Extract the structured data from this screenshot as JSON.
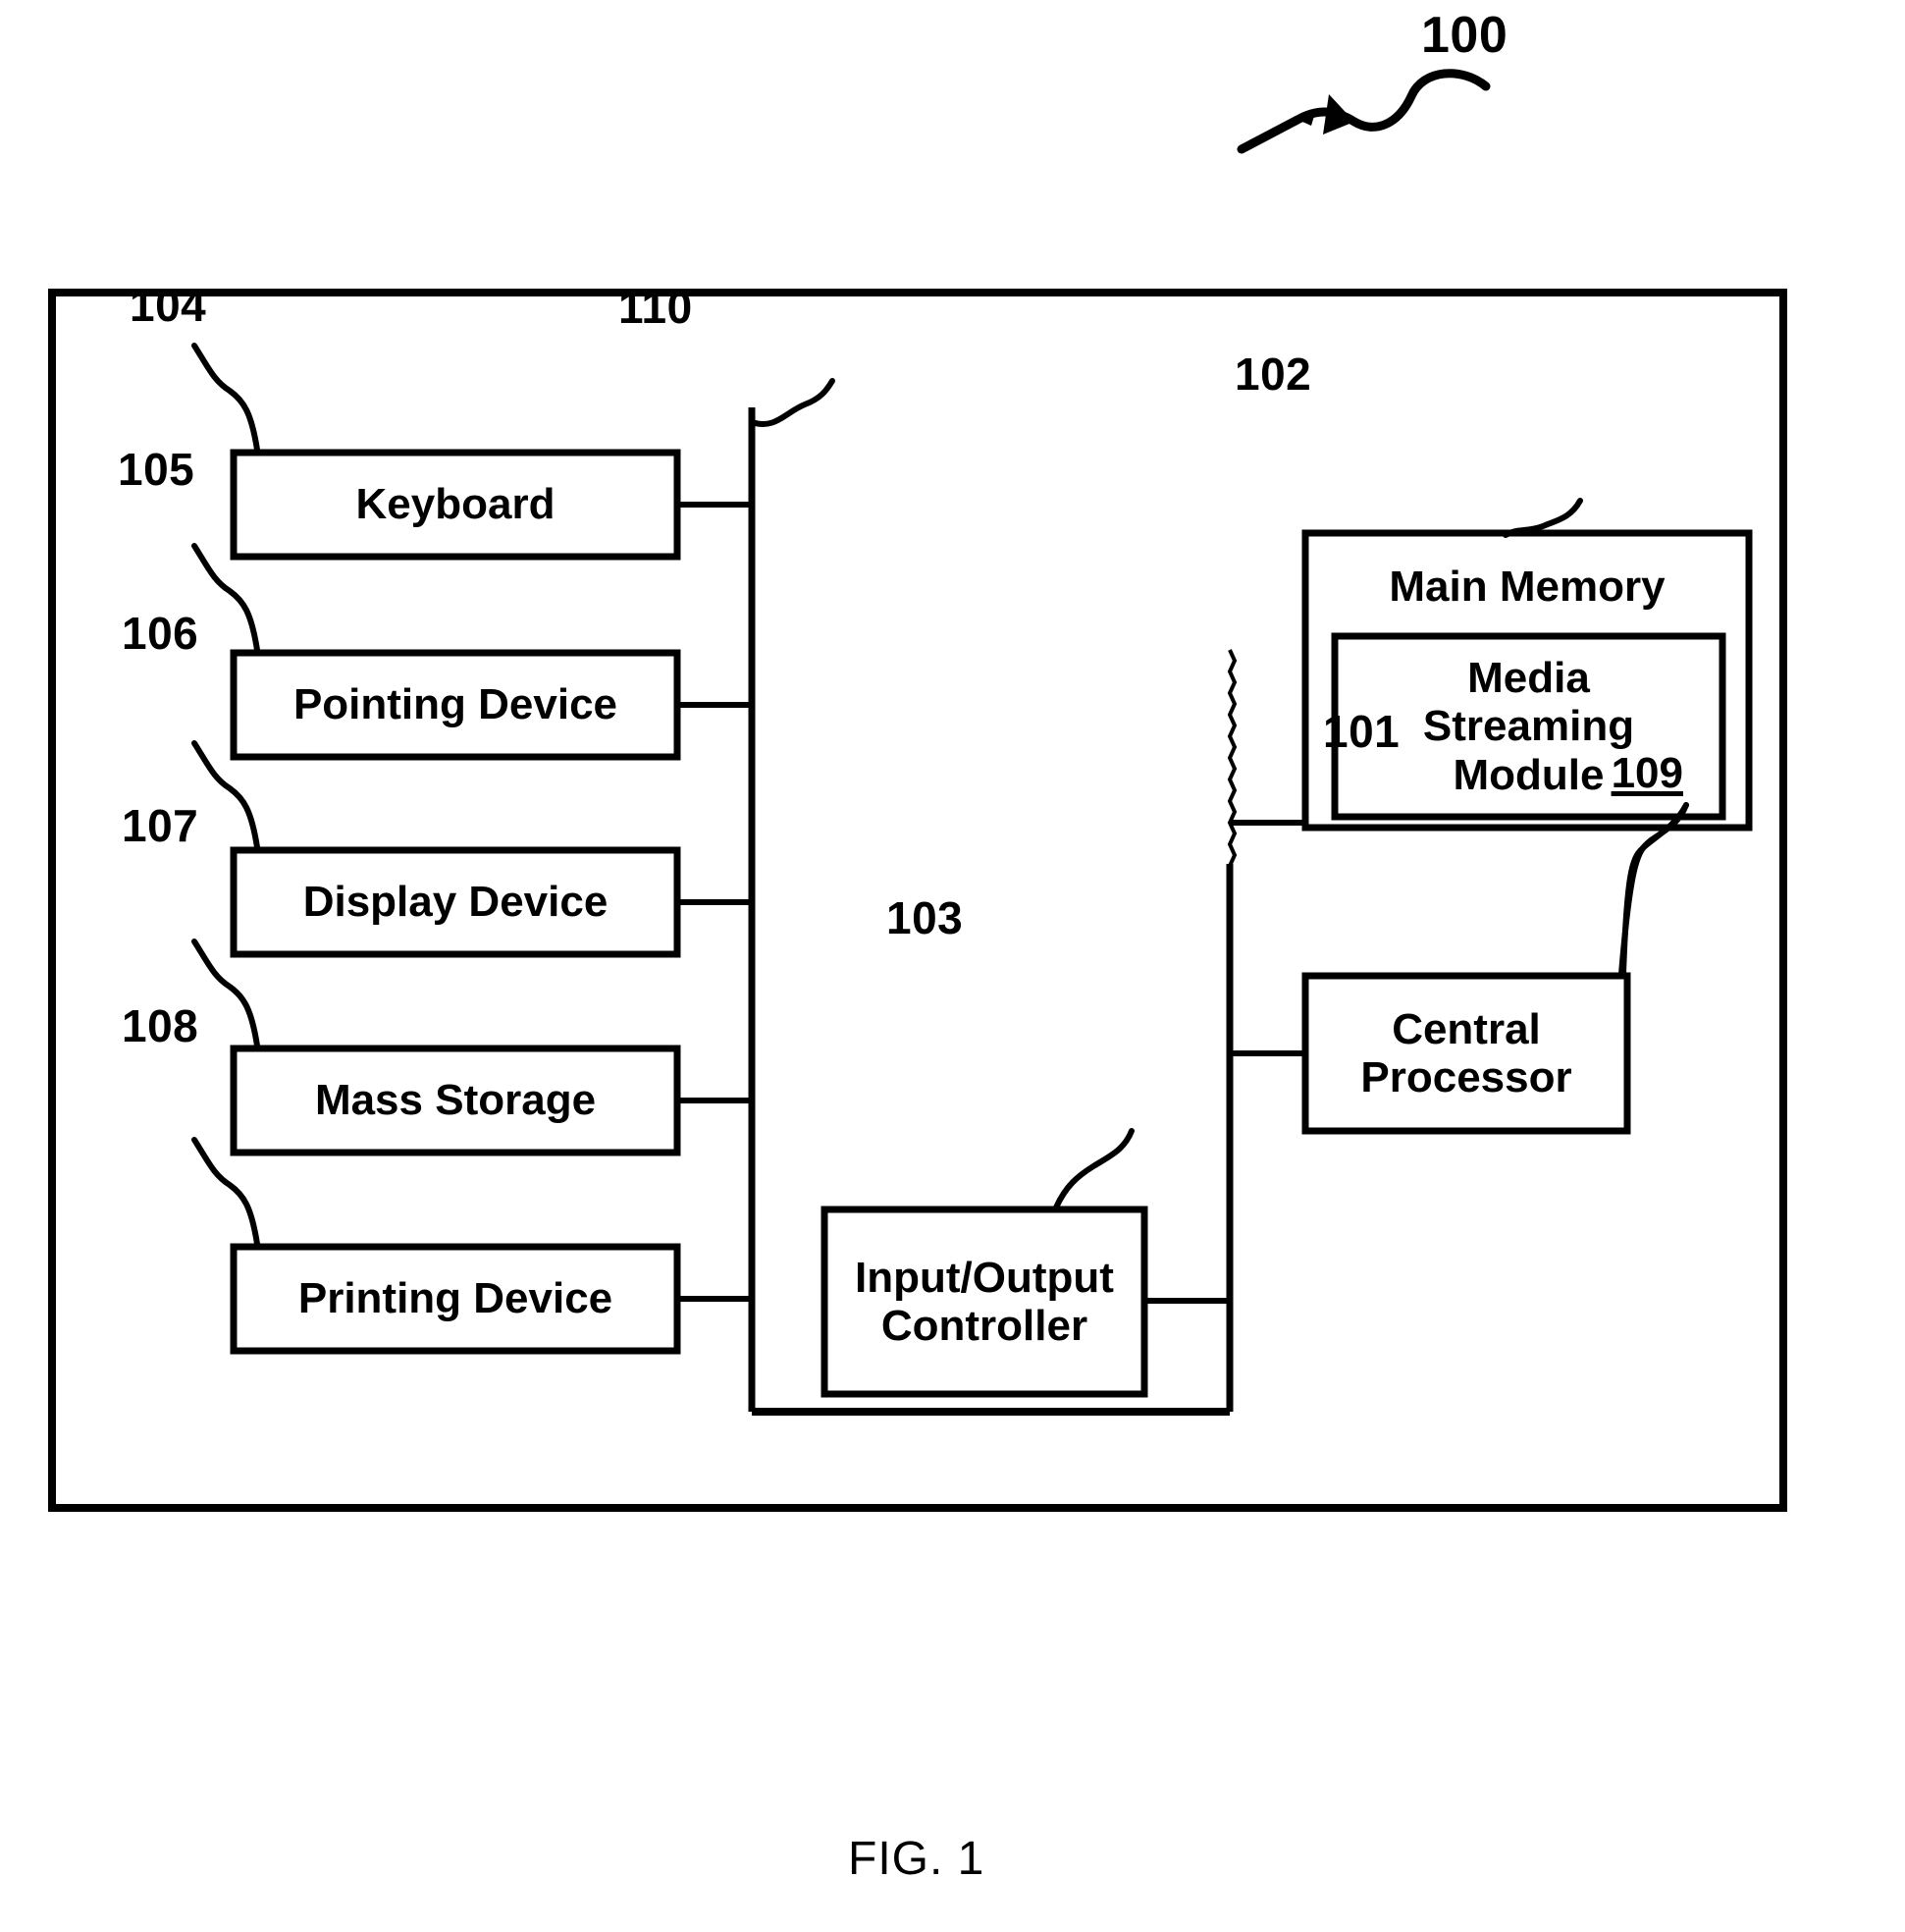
{
  "figure": {
    "caption": "FIG. 1",
    "system_ref": "100"
  },
  "outer_frame": {
    "name": "computer-system-frame"
  },
  "bus": {
    "ref": "110",
    "name": "system-bus"
  },
  "peripherals": [
    {
      "ref": "104",
      "label": "Keyboard"
    },
    {
      "ref": "105",
      "label": "Pointing Device"
    },
    {
      "ref": "106",
      "label": "Display Device"
    },
    {
      "ref": "107",
      "label": "Mass Storage"
    },
    {
      "ref": "108",
      "label": "Printing Device"
    }
  ],
  "io_controller": {
    "ref": "103",
    "label": "Input/Output\nController"
  },
  "main_memory": {
    "ref": "102",
    "label": "Main Memory",
    "module": {
      "ref": "109",
      "label": "Media\nStreaming\nModule "
    }
  },
  "central_processor": {
    "ref": "101",
    "label": "Central\nProcessor"
  }
}
